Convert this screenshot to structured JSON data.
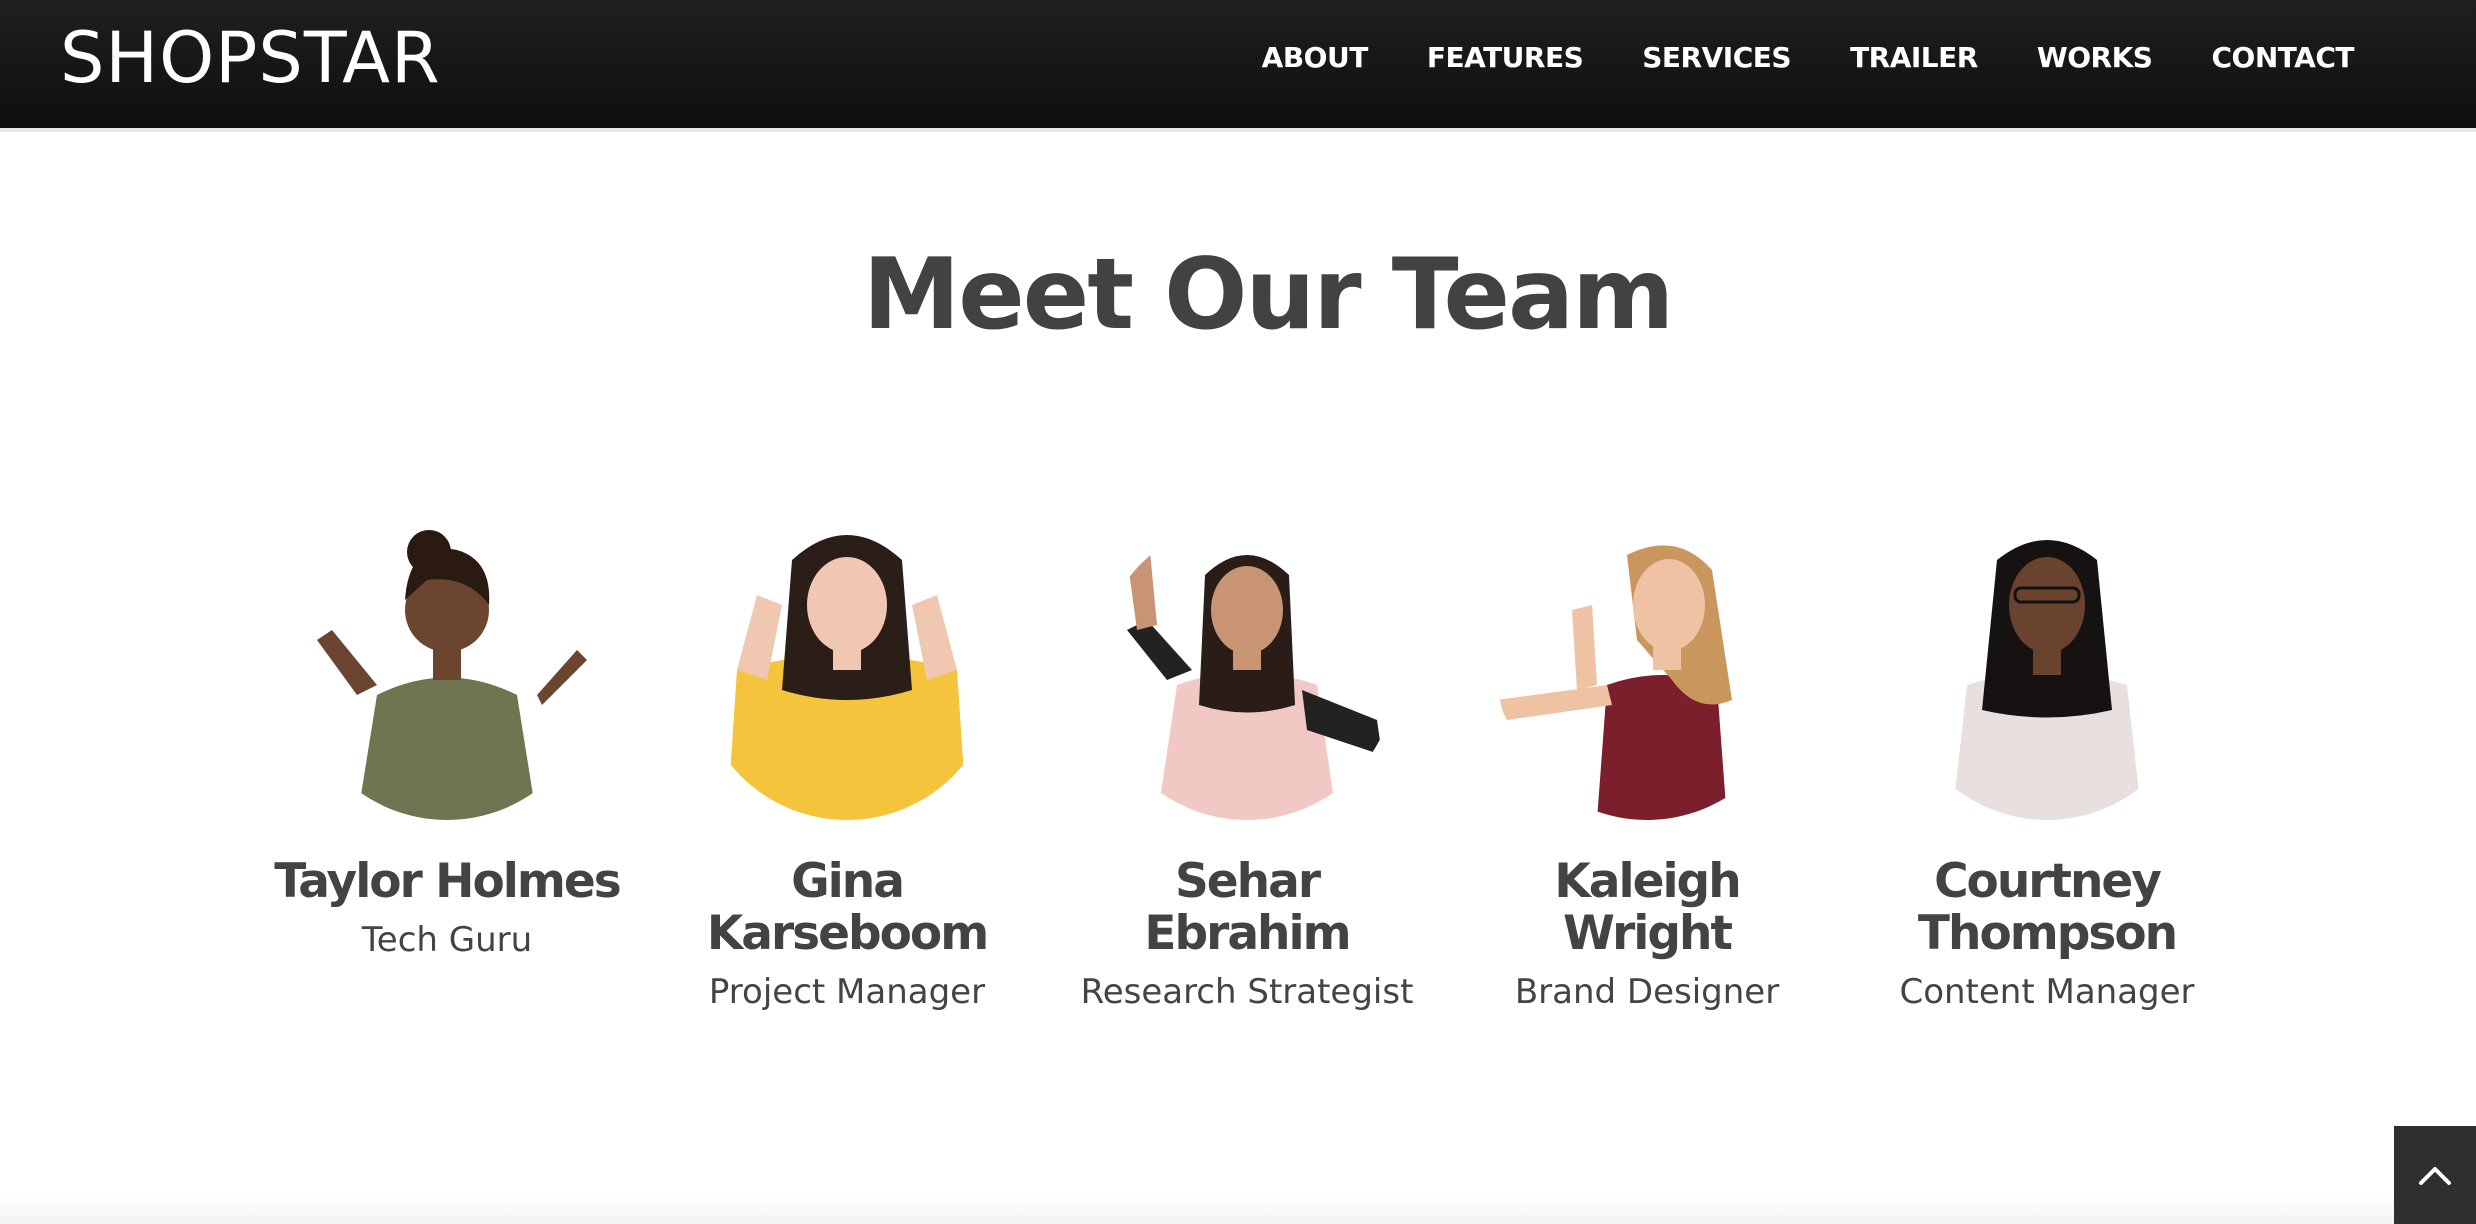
{
  "nav": {
    "brand": "SHOPSTAR",
    "links": [
      "ABOUT",
      "FEATURES",
      "SERVICES",
      "TRAILER",
      "WORKS",
      "CONTACT"
    ]
  },
  "team": {
    "title": "Meet Our Team",
    "members": [
      {
        "name": "Taylor Holmes",
        "role": "Tech Guru",
        "shirt_color": "#6f7550",
        "hair_color": "#2a1a12",
        "skin_color": "#6b4530"
      },
      {
        "name": "Gina Karseboom",
        "role": "Project Manager",
        "shirt_color": "#f3c43c",
        "hair_color": "#2b1d17",
        "skin_color": "#f0c8b2"
      },
      {
        "name": "Sehar Ebrahim",
        "role": "Research Strategist",
        "shirt_color": "#f1c8c4",
        "hair_color": "#2a1d18",
        "skin_color": "#c89474"
      },
      {
        "name": "Kaleigh Wright",
        "role": "Brand Designer",
        "shirt_color": "#7a1f2b",
        "hair_color": "#c9965e",
        "skin_color": "#efc2a4"
      },
      {
        "name": "Courtney Thompson",
        "role": "Content Manager",
        "shirt_color": "#e8e0df",
        "hair_color": "#161212",
        "skin_color": "#6a432e"
      }
    ]
  },
  "back_to_top": {
    "icon": "chevron-up-icon"
  }
}
